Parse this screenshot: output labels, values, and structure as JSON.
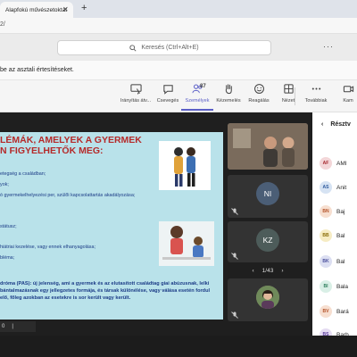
{
  "browser": {
    "tab_title": "Alapfokú művészetoktat",
    "tab_close": "✕",
    "new_tab": "+",
    "url": "2/"
  },
  "teams": {
    "search_placeholder": "Keresés (Ctrl+Alt+E)",
    "more": "···"
  },
  "notice": {
    "text": "be az asztali értesítéseket."
  },
  "toolbar": {
    "items": [
      {
        "label": "Irányítás átv...",
        "icon": "screen-control-icon"
      },
      {
        "label": "Csevegés",
        "icon": "chat-icon"
      },
      {
        "label": "Személyek",
        "icon": "people-icon",
        "count": "87"
      },
      {
        "label": "Kézemelés",
        "icon": "raise-hand-icon"
      },
      {
        "label": "Reagálás",
        "icon": "smiley-icon"
      },
      {
        "label": "Nézet",
        "icon": "grid-view-icon"
      },
      {
        "label": "Továbbiak",
        "icon": "more-icon"
      },
      {
        "label": "Kam",
        "icon": "camera-icon"
      }
    ]
  },
  "slide": {
    "title_line1": "LÉMÁK, AMELYEK A GYERMEK",
    "title_line2": "N FIGYELHETŐK MEG:",
    "lines": [
      "etegség a családban;",
      "yok;",
      "ó gyermekelhelyezési per, szülői kapcsolattartás akadályozása;",
      "státusz;",
      "hiátriai kezelése, vagy ennek elhanyagolása;",
      "bléma;"
    ],
    "para": "dróma (PAS): új jelenség, ami a gyermek és az elutasított családtag giai abúzusnak, lelki bántalmazásnak egy jellegzetes formája, és társak különélése, vagy válása esetén fordul elő, főleg azokban az esetekre is sor került vagy került."
  },
  "slide_nav": {
    "page": "0"
  },
  "tiles": {
    "ni": "NI",
    "kz": "KZ",
    "pager": "1/43",
    "prev": "‹",
    "next": "›"
  },
  "panel": {
    "back": "‹",
    "title": "Résztv",
    "participants": [
      {
        "initials": "AF",
        "name": "AMI",
        "bg": "#f3d6d8",
        "fg": "#a4262c"
      },
      {
        "initials": "AS",
        "name": "Anit",
        "bg": "#d6e3f3",
        "fg": "#2e5a9c"
      },
      {
        "initials": "BN",
        "name": "Baj",
        "bg": "#f7dfd0",
        "fg": "#b4532a"
      },
      {
        "initials": "BB",
        "name": "Bal",
        "bg": "#f6ecc4",
        "fg": "#8a6d0a"
      },
      {
        "initials": "BK",
        "name": "Bal",
        "bg": "#dcdff2",
        "fg": "#4a4f9c"
      },
      {
        "initials": "BI",
        "name": "Bala",
        "bg": "#d9efe6",
        "fg": "#2e7d5b"
      },
      {
        "initials": "BV",
        "name": "Bará",
        "bg": "#f7dfd0",
        "fg": "#b4532a"
      },
      {
        "initials": "BS",
        "name": "Barb",
        "bg": "#e5dcf2",
        "fg": "#5b3c9c"
      }
    ]
  },
  "colors": {
    "accent": "#5b5fc7",
    "slide_bg": "#b9e2ea",
    "slide_title": "#b52a2a",
    "slide_text": "#1b3b86"
  }
}
